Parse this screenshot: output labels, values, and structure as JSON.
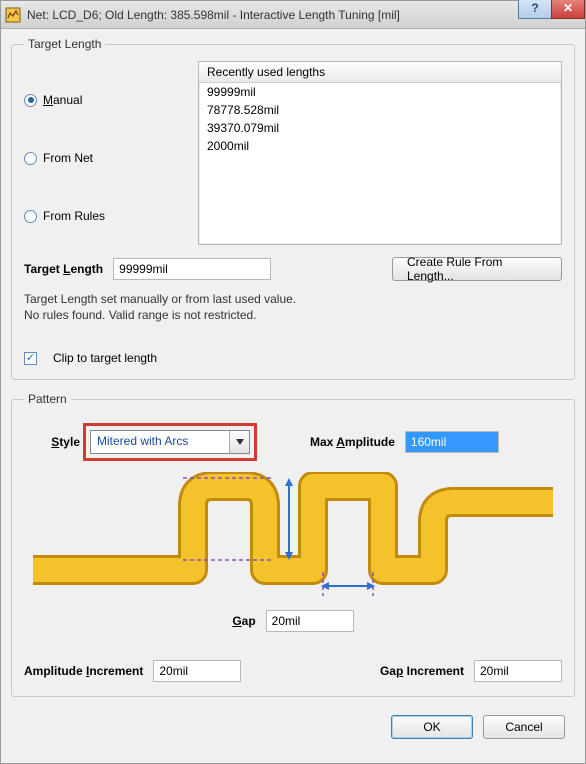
{
  "title": "Net: LCD_D6;  Old Length: 385.598mil  -  Interactive Length Tuning [mil]",
  "target_length_group": {
    "legend": "Target Length",
    "radios": {
      "manual": "Manual",
      "from_net": "From Net",
      "from_rules": "From Rules",
      "selected": "manual"
    },
    "listbox": {
      "header": "Recently used lengths",
      "items": [
        "99999mil",
        "78778.528mil",
        "39370.079mil",
        "2000mil"
      ]
    },
    "target_length_label": "Target Length",
    "target_length_value": "99999mil",
    "create_rule_btn": "Create Rule From Length...",
    "note_line1": "Target Length set manually or from last used value.",
    "note_line2": " No rules found. Valid range is not restricted.",
    "clip_label": "Clip to target length",
    "clip_checked": true
  },
  "pattern_group": {
    "legend": "Pattern",
    "style_label": "Style",
    "style_value": "Mitered with Arcs",
    "max_amp_label": "Max Amplitude",
    "max_amp_value": "160mil",
    "gap_label": "Gap",
    "gap_value": "20mil",
    "amp_inc_label": "Amplitude Increment",
    "amp_inc_value": "20mil",
    "gap_inc_label": "Gap Increment",
    "gap_inc_value": "20mil"
  },
  "buttons": {
    "ok": "OK",
    "cancel": "Cancel"
  }
}
